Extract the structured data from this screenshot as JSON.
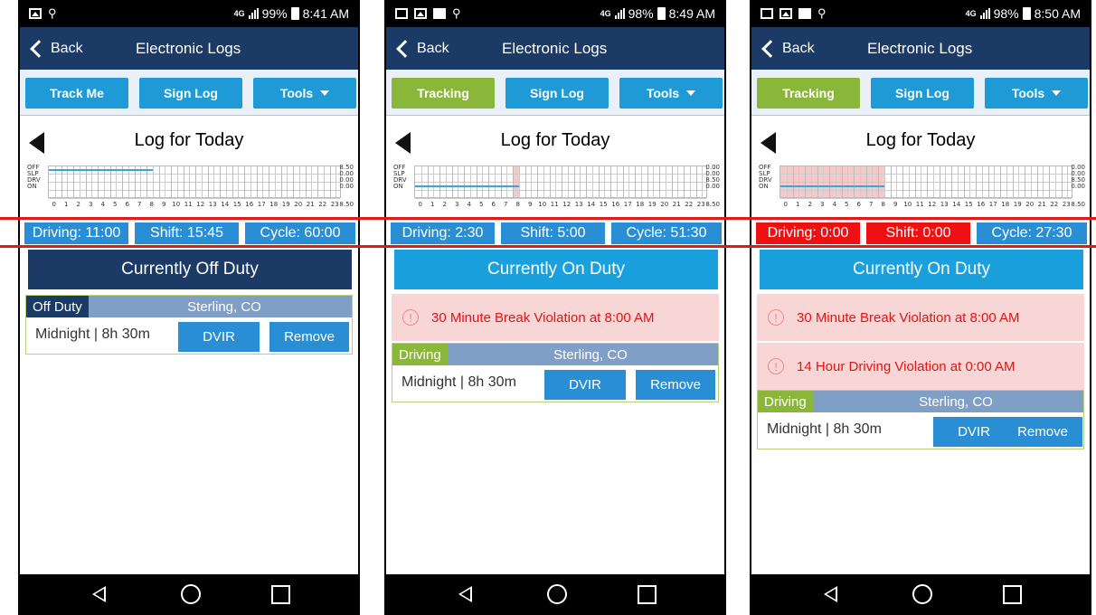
{
  "screens": [
    {
      "status_bar": {
        "signal_type": "4G LTE",
        "battery": "99%",
        "time": "8:41 AM",
        "icons": [
          "image-icon",
          "usb-icon"
        ]
      },
      "nav": {
        "back_label": "Back",
        "title": "Electronic Logs"
      },
      "toolbar": {
        "primary_label": "Track Me",
        "primary_state": "inactive",
        "sign_label": "Sign Log",
        "tools_label": "Tools"
      },
      "log_title": "Log for Today",
      "grid": {
        "row_labels": [
          "OFF",
          "SLP",
          "DRV",
          "ON"
        ],
        "totals": [
          "8.50",
          "0.00",
          "0.00",
          "0.00"
        ],
        "hour_labels": [
          "0",
          "1",
          "2",
          "3",
          "4",
          "5",
          "6",
          "7",
          "8",
          "9",
          "10",
          "11",
          "12",
          "13",
          "14",
          "15",
          "16",
          "17",
          "18",
          "19",
          "20",
          "21",
          "22",
          "23"
        ],
        "sum": "8.50",
        "duty_line": {
          "status_row": "OFF",
          "from_hour": 0,
          "to_hour": 8.5
        },
        "violation_span_hours": null
      },
      "summary": {
        "driving": "Driving: 11:00",
        "shift": "Shift: 15:45",
        "cycle": "Cycle: 60:00",
        "driving_color": "#2a8ed4",
        "shift_color": "#2a8ed4",
        "cycle_color": "#2a8ed4"
      },
      "duty_status": "Currently Off Duty",
      "violations": [],
      "entry": {
        "status": "Off Duty",
        "location": "Sterling, CO",
        "time": "Midnight | 8h 30m",
        "dvir_label": "DVIR",
        "remove_label": "Remove"
      }
    },
    {
      "status_bar": {
        "signal_type": "4G LTE",
        "battery": "98%",
        "time": "8:49 AM",
        "icons": [
          "mail-icon",
          "image-icon",
          "white-square-icon",
          "usb-icon"
        ]
      },
      "nav": {
        "back_label": "Back",
        "title": "Electronic Logs"
      },
      "toolbar": {
        "primary_label": "Tracking",
        "primary_state": "active",
        "sign_label": "Sign Log",
        "tools_label": "Tools"
      },
      "log_title": "Log for Today",
      "grid": {
        "row_labels": [
          "OFF",
          "SLP",
          "DRV",
          "ON"
        ],
        "totals": [
          "0.00",
          "0.00",
          "8.50",
          "0.00"
        ],
        "hour_labels": [
          "0",
          "1",
          "2",
          "3",
          "4",
          "5",
          "6",
          "7",
          "8",
          "9",
          "10",
          "11",
          "12",
          "13",
          "14",
          "15",
          "16",
          "17",
          "18",
          "19",
          "20",
          "21",
          "22",
          "23"
        ],
        "sum": "8.50",
        "duty_line": {
          "status_row": "DRV",
          "from_hour": 0,
          "to_hour": 8.5
        },
        "violation_span_hours": [
          8,
          8.5
        ]
      },
      "summary": {
        "driving": "Driving: 2:30",
        "shift": "Shift: 5:00",
        "cycle": "Cycle: 51:30",
        "driving_color": "#2a8ed4",
        "shift_color": "#2a8ed4",
        "cycle_color": "#2a8ed4"
      },
      "duty_status": "Currently On Duty",
      "violations": [
        "30 Minute Break Violation at 8:00 AM"
      ],
      "entry": {
        "status": "Driving",
        "location": "Sterling, CO",
        "time": "Midnight | 8h 30m",
        "dvir_label": "DVIR",
        "remove_label": "Remove"
      }
    },
    {
      "status_bar": {
        "signal_type": "4G LTE",
        "battery": "98%",
        "time": "8:50 AM",
        "icons": [
          "mail-icon",
          "image-icon",
          "white-square-icon",
          "usb-icon"
        ]
      },
      "nav": {
        "back_label": "Back",
        "title": "Electronic Logs"
      },
      "toolbar": {
        "primary_label": "Tracking",
        "primary_state": "active",
        "sign_label": "Sign Log",
        "tools_label": "Tools"
      },
      "log_title": "Log for Today",
      "grid": {
        "row_labels": [
          "OFF",
          "SLP",
          "DRV",
          "ON"
        ],
        "totals": [
          "0.00",
          "0.00",
          "8.50",
          "0.00"
        ],
        "hour_labels": [
          "0",
          "1",
          "2",
          "3",
          "4",
          "5",
          "6",
          "7",
          "8",
          "9",
          "10",
          "11",
          "12",
          "13",
          "14",
          "15",
          "16",
          "17",
          "18",
          "19",
          "20",
          "21",
          "22",
          "23"
        ],
        "sum": "8.50",
        "duty_line": {
          "status_row": "DRV",
          "from_hour": 0,
          "to_hour": 8.5
        },
        "violation_span_hours": [
          0,
          8.5
        ]
      },
      "summary": {
        "driving": "Driving: 0:00",
        "shift": "Shift: 0:00",
        "cycle": "Cycle: 27:30",
        "driving_color": "#ee1111",
        "shift_color": "#ee1111",
        "cycle_color": "#2a8ed4"
      },
      "duty_status": "Currently On Duty",
      "violations": [
        "30 Minute Break Violation at 8:00 AM",
        "14 Hour Driving Violation at 0:00 AM"
      ],
      "entry": {
        "status": "Driving",
        "location": "Sterling, CO",
        "time": "Midnight | 8h 30m",
        "dvir_label": "DVIR",
        "remove_label": "Remove"
      }
    }
  ],
  "colors": {
    "navy": "#1b3a66",
    "button_blue": "#1e9ad6",
    "tracking_green": "#8ab73a",
    "summary_blue": "#2a8ed4",
    "alert_red": "#ee1111",
    "highlight_line": "#e01919",
    "violation_bg": "#f8d6d6"
  }
}
